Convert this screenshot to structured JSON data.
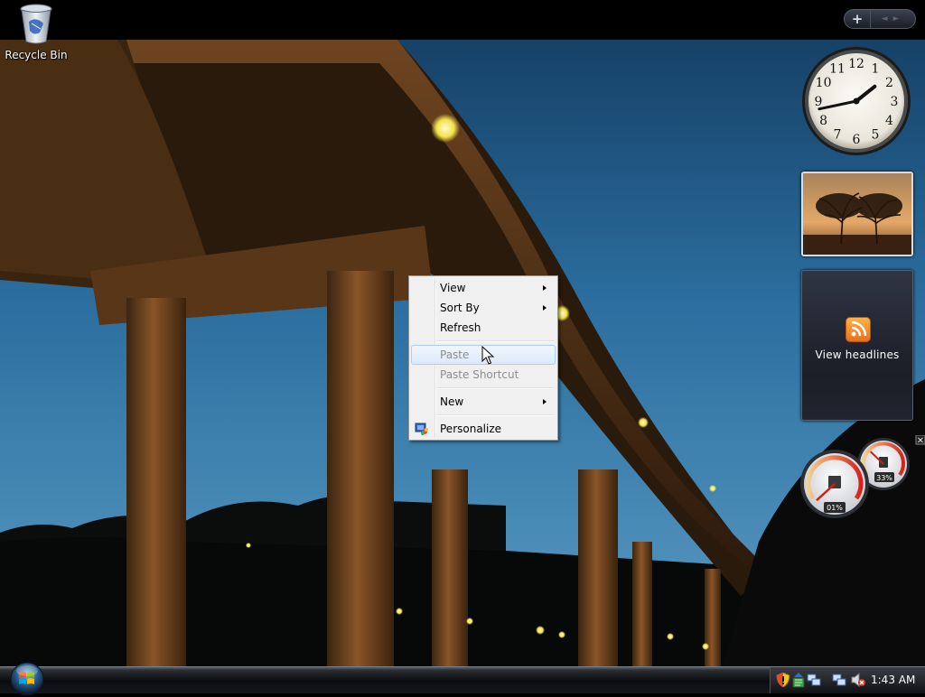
{
  "desktop": {
    "icons": [
      {
        "label": "Recycle Bin"
      }
    ]
  },
  "sidebar": {
    "controls": {
      "add_symbol": "+",
      "prev_symbol": "◄",
      "next_symbol": "►"
    },
    "clock": {
      "numerals": [
        "12",
        "1",
        "2",
        "3",
        "4",
        "5",
        "6",
        "7",
        "8",
        "9",
        "10",
        "11"
      ],
      "hour": 1,
      "minute": 43
    },
    "slideshow": {
      "subject": "trees at sunset"
    },
    "feed": {
      "caption": "View headlines",
      "icon": "rss-icon"
    },
    "cpu_meter": {
      "cpu_label": "01%",
      "memory_label": "33%",
      "cpu_percent": 1,
      "memory_percent": 33,
      "close_symbol": "×"
    }
  },
  "context_menu": {
    "items": [
      {
        "label": "View",
        "submenu": true,
        "enabled": true
      },
      {
        "label": "Sort By",
        "submenu": true,
        "enabled": true
      },
      {
        "label": "Refresh",
        "submenu": false,
        "enabled": true
      },
      {
        "label": "Paste",
        "submenu": false,
        "enabled": false,
        "highlighted": true
      },
      {
        "label": "Paste Shortcut",
        "submenu": false,
        "enabled": false
      },
      {
        "label": "New",
        "submenu": true,
        "enabled": true
      },
      {
        "label": "Personalize",
        "submenu": false,
        "enabled": true,
        "icon": "personalize-icon"
      }
    ]
  },
  "taskbar": {
    "start_button": "start-orb-icon",
    "tray_icons": [
      "security-shield-icon",
      "windows-update-icon",
      "network-icon",
      "volume-muted-icon"
    ],
    "time": "1:43 AM"
  },
  "colors": {
    "sky": "#2f6e9e",
    "bridge": "#7a4a1e",
    "menu_bg": "#f0f0f0",
    "menu_highlight_border": "#aeccf1",
    "rss_orange": "#f7931e"
  }
}
